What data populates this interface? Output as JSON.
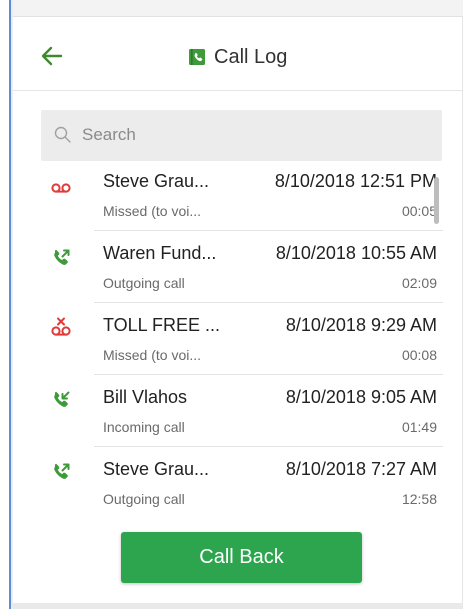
{
  "colors": {
    "accent_green": "#2da44e",
    "missed_red": "#e03a3a",
    "header_arrow": "#3f8a2f"
  },
  "header": {
    "back_icon": "back-arrow-icon",
    "title_icon": "call-log-book-icon",
    "title": "Call Log"
  },
  "search": {
    "icon": "search-icon",
    "placeholder": "Search",
    "value": ""
  },
  "calls": [
    {
      "icon": "voicemail-icon",
      "name": "Steve Grau...",
      "datetime": "8/10/2018 12:51 PM",
      "type": "Missed (to voi...",
      "duration": "00:05"
    },
    {
      "icon": "outgoing-call-icon",
      "name": "Waren Fund...",
      "datetime": "8/10/2018 10:55 AM",
      "type": "Outgoing call",
      "duration": "02:09"
    },
    {
      "icon": "missed-voicemail-icon",
      "name": "TOLL FREE ...",
      "datetime": "8/10/2018 9:29 AM",
      "type": "Missed (to voi...",
      "duration": "00:08"
    },
    {
      "icon": "incoming-call-icon",
      "name": "Bill Vlahos",
      "datetime": "8/10/2018 9:05 AM",
      "type": "Incoming call",
      "duration": "01:49"
    },
    {
      "icon": "outgoing-call-icon",
      "name": "Steve Grau...",
      "datetime": "8/10/2018 7:27 AM",
      "type": "Outgoing call",
      "duration": "12:58"
    }
  ],
  "actions": {
    "call_back_label": "Call Back"
  }
}
